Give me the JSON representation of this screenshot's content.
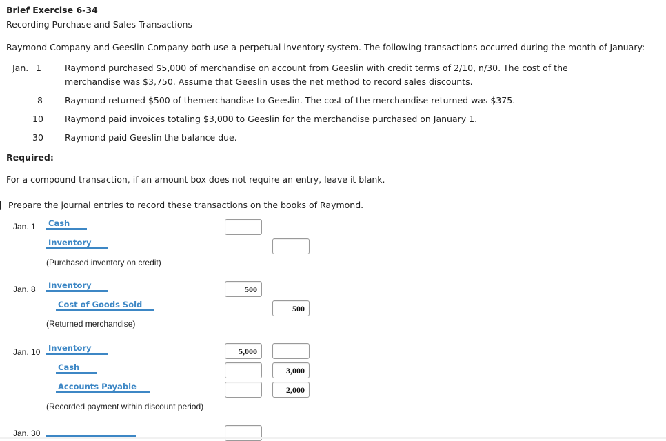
{
  "header": {
    "title": "Brief Exercise 6-34",
    "subtitle": "Recording Purchase and Sales Transactions"
  },
  "intro": "Raymond Company and Geeslin Company both use a perpetual inventory system. The following transactions occurred during the month of January:",
  "transactions": [
    {
      "month": "Jan.",
      "day": "1",
      "line1": "Raymond purchased $5,000 of merchandise on account from Geeslin with credit terms of 2/10, n/30. The cost of the",
      "line2": "merchandise was $3,750. Assume that Geeslin uses the net method to record sales discounts."
    },
    {
      "day": "8",
      "line1": "Raymond returned $500 of themerchandise to Geeslin. The cost of the merchandise returned was $375."
    },
    {
      "day": "10",
      "line1": "Raymond paid invoices totaling $3,000 to Geeslin for the merchandise purchased on January 1."
    },
    {
      "day": "30",
      "line1": "Raymond paid Geeslin the balance due."
    }
  ],
  "required_label": "Required:",
  "instruction": "For a compound transaction, if an amount box does not require an entry, leave it blank.",
  "prompt": "Prepare the journal entries to record these transactions on the books of Raymond.",
  "journal": [
    {
      "date": "Jan. 1",
      "lines": [
        {
          "account": "Cash",
          "debit": "",
          "credit": null
        },
        {
          "account": "Inventory",
          "debit": null,
          "credit": ""
        }
      ],
      "memo": "(Purchased inventory on credit)"
    },
    {
      "date": "Jan. 8",
      "lines": [
        {
          "account": "Inventory",
          "debit": "500",
          "credit": null
        },
        {
          "account": "Cost of Goods Sold",
          "debit": null,
          "credit": "500"
        }
      ],
      "memo": "(Returned merchandise)"
    },
    {
      "date": "Jan. 10",
      "lines": [
        {
          "account": "Inventory",
          "debit": "5,000",
          "credit": ""
        },
        {
          "account": "Cash",
          "debit": "",
          "credit": "3,000"
        },
        {
          "account": "Accounts Payable",
          "debit": "",
          "credit": "2,000"
        }
      ],
      "memo": "(Recorded payment within discount period)"
    },
    {
      "date": "Jan. 30",
      "lines": [
        {
          "account": "",
          "debit": "",
          "credit": null
        }
      ]
    }
  ],
  "colors": {
    "account_link": "#3d87c5",
    "input_border": "#9a9a9a",
    "text": "#222222"
  }
}
